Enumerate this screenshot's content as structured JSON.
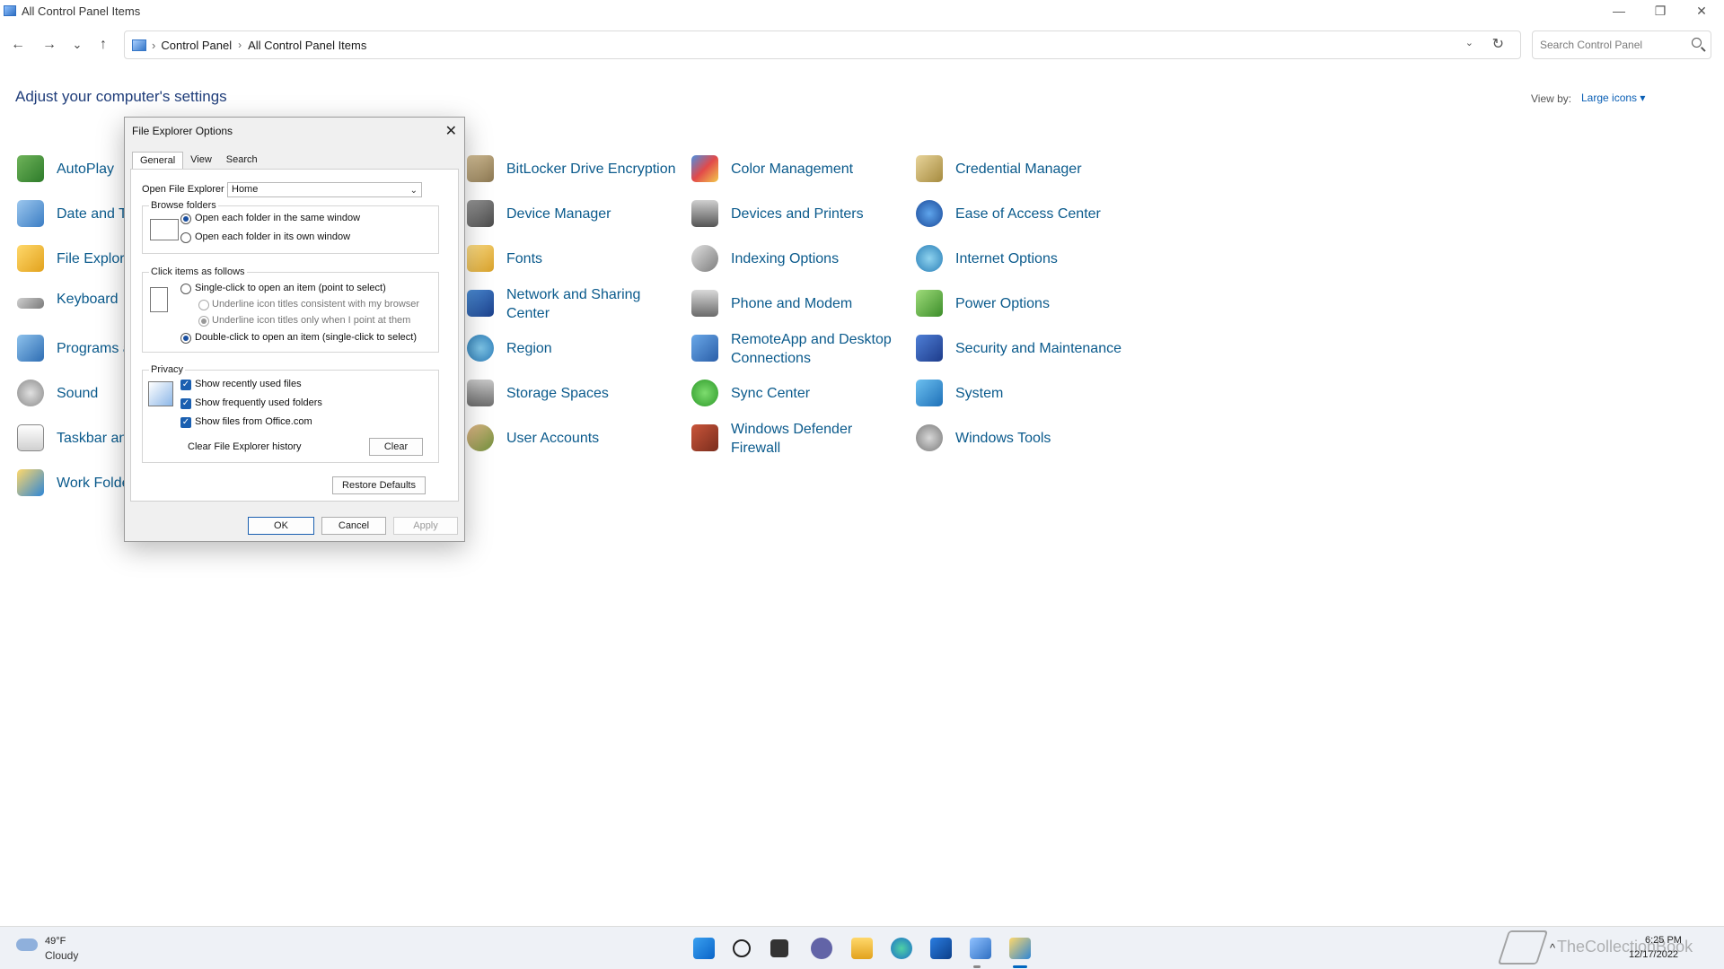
{
  "window": {
    "title": "All Control Panel Items",
    "minimize": "—",
    "restore": "❐",
    "close": "✕"
  },
  "nav": {
    "back": "←",
    "forward": "→",
    "recent": "⌄",
    "up": "↑"
  },
  "address": {
    "crumb1": "Control Panel",
    "crumb2": "All Control Panel Items",
    "separator": "›",
    "dropdown": "⌄",
    "refresh": "↻"
  },
  "search": {
    "placeholder": "Search Control Panel"
  },
  "header": {
    "title": "Adjust your computer's settings",
    "viewby_label": "View by:",
    "viewby_value": "Large icons ▾"
  },
  "items": {
    "col1": [
      "AutoPlay",
      "Date and Ti",
      "File Explore",
      "Keyboard",
      "Programs a",
      "Sound",
      "Taskbar an",
      "Work Folde"
    ],
    "col2": [
      "BitLocker Drive Encryption",
      "Device Manager",
      "Fonts",
      "Network and Sharing",
      "Center",
      "Region",
      "Storage Spaces",
      "User Accounts"
    ],
    "col3": [
      "Color Management",
      "Devices and Printers",
      "Indexing Options",
      "Phone and Modem",
      "RemoteApp and Desktop",
      "Connections",
      "Sync Center",
      "Windows Defender",
      "Firewall"
    ],
    "col4": [
      "Credential Manager",
      "Ease of Access Center",
      "Internet Options",
      "Power Options",
      "Security and Maintenance",
      "System",
      "Windows Tools"
    ]
  },
  "dialog": {
    "title": "File Explorer Options",
    "close": "✕",
    "tabs": [
      "General",
      "View",
      "Search"
    ],
    "open_to_label": "Open File Explorer to:",
    "open_to_value": "Home",
    "chevron": "⌄",
    "browse_title": "Browse folders",
    "browse_same": "Open each folder in the same window",
    "browse_own": "Open each folder in its own window",
    "click_title": "Click items as follows",
    "single_click": "Single-click to open an item (point to select)",
    "underline_browser": "Underline icon titles consistent with my browser",
    "underline_point": "Underline icon titles only when I point at them",
    "double_click": "Double-click to open an item (single-click to select)",
    "privacy_title": "Privacy",
    "recent_files": "Show recently used files",
    "frequent_folders": "Show frequently used folders",
    "office_files": "Show files from Office.com",
    "clear_history": "Clear File Explorer history",
    "clear_btn": "Clear",
    "restore_btn": "Restore Defaults",
    "ok": "OK",
    "cancel": "Cancel",
    "apply": "Apply",
    "checkmark": "✓"
  },
  "taskbar": {
    "temp": "49°F",
    "condition": "Cloudy",
    "time": "6:25 PM",
    "date": "12/17/2022",
    "tray_chevron": "^",
    "watermark": "TheCollectionBook"
  },
  "colors": {
    "link": "#0a5a8c",
    "accent": "#0067c0",
    "dialog_bg": "#f0f0f0"
  }
}
